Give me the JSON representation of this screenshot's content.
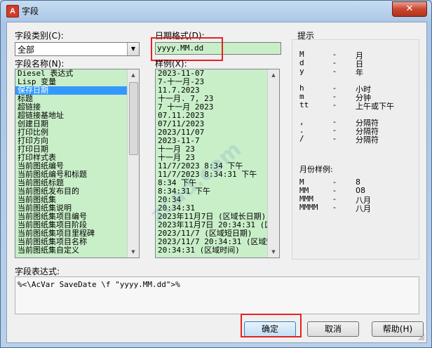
{
  "window": {
    "title": "字段",
    "app_icon_letter": "A",
    "close_glyph": "✕"
  },
  "category": {
    "label": "字段类别(C):",
    "selected": "全部",
    "arrow_glyph": "▼"
  },
  "field_names": {
    "label": "字段名称(N):",
    "selected_index": 2,
    "items": [
      "Diesel 表达式",
      "Lisp 变量",
      "保存日期",
      "标题",
      "超链接",
      "超链接基地址",
      "创建日期",
      "打印比例",
      "打印方向",
      "打印日期",
      "打印样式表",
      "当前图纸编号",
      "当前图纸编号和标题",
      "当前图纸标题",
      "当前图纸发布目的",
      "当前图纸集",
      "当前图纸集说明",
      "当前图纸集项目编号",
      "当前图纸集项目阶段",
      "当前图纸集项目里程碑",
      "当前图纸集项目名称",
      "当前图纸集自定义"
    ]
  },
  "date_format": {
    "label": "日期格式(D):",
    "value": "yyyy.MM.dd"
  },
  "examples": {
    "label": "样例(X):",
    "items": [
      "2023-11-07",
      "7-十一月-23",
      "11.7.2023",
      "十一月. 7, 23",
      "7 十一月 2023",
      "07.11.2023",
      "07/11/2023",
      "2023/11/07",
      "2023-11-7",
      "十一月 23",
      "十一月 23",
      "11/7/2023 8:34 下午",
      "11/7/2023 8:34:31 下午",
      "8:34 下午",
      "8:34:31 下午",
      "20:34",
      "20:34:31",
      "2023年11月7日 (区域长日期)",
      "2023年11月7日 20:34:31 (区",
      "2023/11/7 (区域短日期)",
      "2023/11/7 20:34:31 (区域短",
      "20:34:31 (区域时间)"
    ]
  },
  "hints": {
    "title": "提示",
    "rows": [
      {
        "key": "M",
        "dash": "-",
        "val": "月"
      },
      {
        "key": "d",
        "dash": "-",
        "val": "日"
      },
      {
        "key": "y",
        "dash": "-",
        "val": "年"
      },
      {
        "key": "h",
        "dash": "-",
        "val": "小时"
      },
      {
        "key": "m",
        "dash": "-",
        "val": "分钟"
      },
      {
        "key": "tt",
        "dash": "-",
        "val": "上午或下午"
      },
      {
        "key": ",",
        "dash": "-",
        "val": "分隔符"
      },
      {
        "key": ".",
        "dash": "-",
        "val": "分隔符"
      },
      {
        "key": "/",
        "dash": "-",
        "val": "分隔符"
      }
    ],
    "month_title": "月份样例:",
    "month_rows": [
      {
        "key": "M",
        "dash": "-",
        "val": "8"
      },
      {
        "key": "MM",
        "dash": "-",
        "val": "08"
      },
      {
        "key": "MMM",
        "dash": "-",
        "val": "八月"
      },
      {
        "key": "MMMM",
        "dash": "-",
        "val": "八月"
      }
    ]
  },
  "expression": {
    "label": "字段表达式:",
    "value": "%<\\AcVar SaveDate \\f \"yyyy.MM.dd\">%"
  },
  "buttons": {
    "ok": "确定",
    "cancel": "取消",
    "help": "帮助(H)"
  },
  "watermark": "zcad.com",
  "colors": {
    "list_bg": "#c9efc9",
    "selection": "#3399ff",
    "highlight": "#e52222"
  }
}
